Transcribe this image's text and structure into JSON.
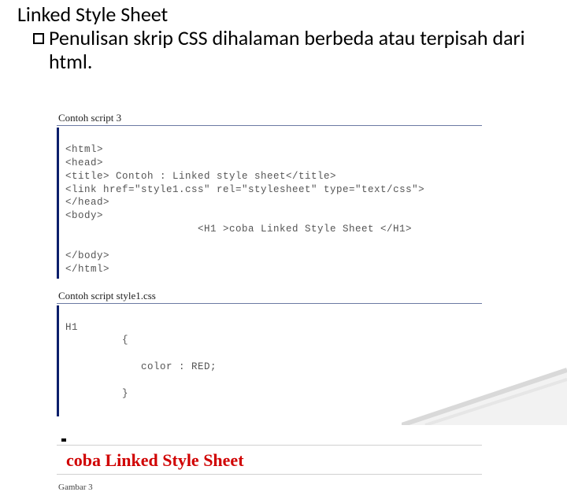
{
  "heading": {
    "title": "Linked Style Sheet",
    "bullet": "Penulisan skrip CSS dihalaman berbeda atau terpisah dari html."
  },
  "block1": {
    "caption": "Contoh script 3",
    "lines": [
      "<html>",
      "<head>",
      "<title> Contoh : Linked style sheet</title>",
      "<link href=\"style1.css\" rel=\"stylesheet\" type=\"text/css\">",
      "</head>",
      "<body>",
      "        <H1 >coba Linked Style Sheet </H1>",
      "</body>",
      "</html>"
    ]
  },
  "block2": {
    "caption": "Contoh script style1.css",
    "lines": [
      "H1",
      "   {",
      "      color : RED;",
      "   }"
    ]
  },
  "result": {
    "text": "coba Linked Style Sheet"
  },
  "footer": {
    "gambar": "Gambar 3"
  }
}
